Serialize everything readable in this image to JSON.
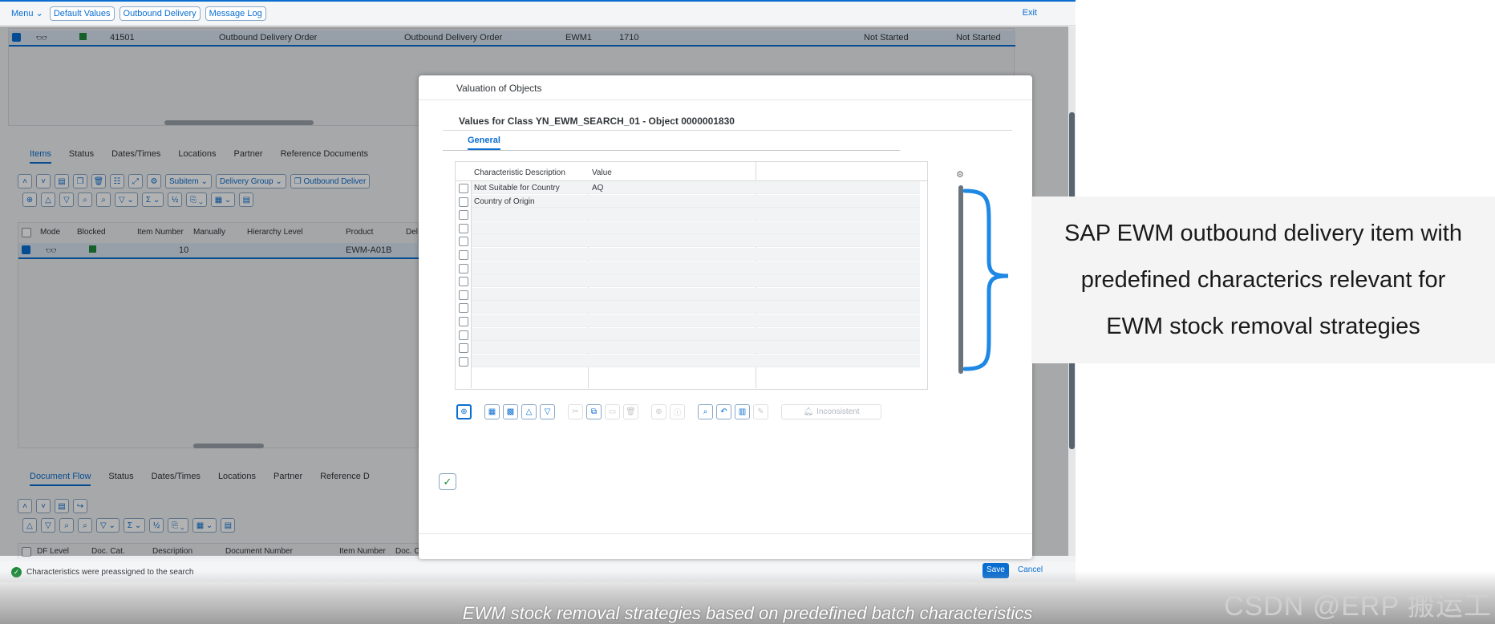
{
  "shell": {
    "menu_label": "Menu",
    "buttons": [
      "Default Values",
      "Outbound Delivery",
      "Message Log"
    ],
    "exit_label": "Exit"
  },
  "header_table": {
    "row": {
      "document": "41501",
      "type1": "Outbound Delivery Order",
      "type2": "Outbound Delivery Order",
      "warehouse": "EWM1",
      "plant": "1710",
      "status1": "Not Started",
      "status2": "Not Started"
    }
  },
  "item_tabs": [
    "Items",
    "Status",
    "Dates/Times",
    "Locations",
    "Partner",
    "Reference Documents"
  ],
  "item_toolbar": {
    "subitem": "Subitem",
    "delivery_group": "Delivery Group",
    "outbound_delivery": "Outbound Deliver"
  },
  "item_table": {
    "columns": [
      "Mode",
      "Blocked",
      "Item Number",
      "Manually",
      "Hierarchy Level",
      "Product",
      "Del"
    ],
    "row": {
      "item_number": "10",
      "product": "EWM-A01B"
    }
  },
  "flow_tabs": [
    "Document Flow",
    "Status",
    "Dates/Times",
    "Locations",
    "Partner",
    "Reference D"
  ],
  "flow_table": {
    "columns": [
      "DF Level",
      "Doc. Cat.",
      "Description",
      "Document Number",
      "Item Number",
      "Doc. C"
    ]
  },
  "status_bar": {
    "message": "Characteristics were preassigned to the search",
    "save_label": "Save",
    "cancel_label": "Cancel"
  },
  "dialog": {
    "title": "Valuation of Objects",
    "subtitle": "Values for Class YN_EWM_SEARCH_01 - Object 0000001830",
    "tab": "General",
    "grid": {
      "columns": [
        "Characteristic Description",
        "Value"
      ],
      "rows": [
        {
          "description": "Not Suitable for Country",
          "value": "AQ"
        },
        {
          "description": "Country of Origin",
          "value": ""
        }
      ],
      "empty_rows": 12
    },
    "inconsistent_label": "Inconsistent"
  },
  "annotation": {
    "lines": [
      "SAP EWM outbound delivery item with",
      "predefined characterics relevant for",
      "EWM stock removal strategies"
    ],
    "brace_color": "#1e88e5"
  },
  "caption": "EWM stock removal strategies based on predefined batch characteristics",
  "watermark": "CSDN @ERP 搬运工",
  "colors": {
    "accent": "#0a6ed1",
    "success": "#1f8a3c"
  }
}
